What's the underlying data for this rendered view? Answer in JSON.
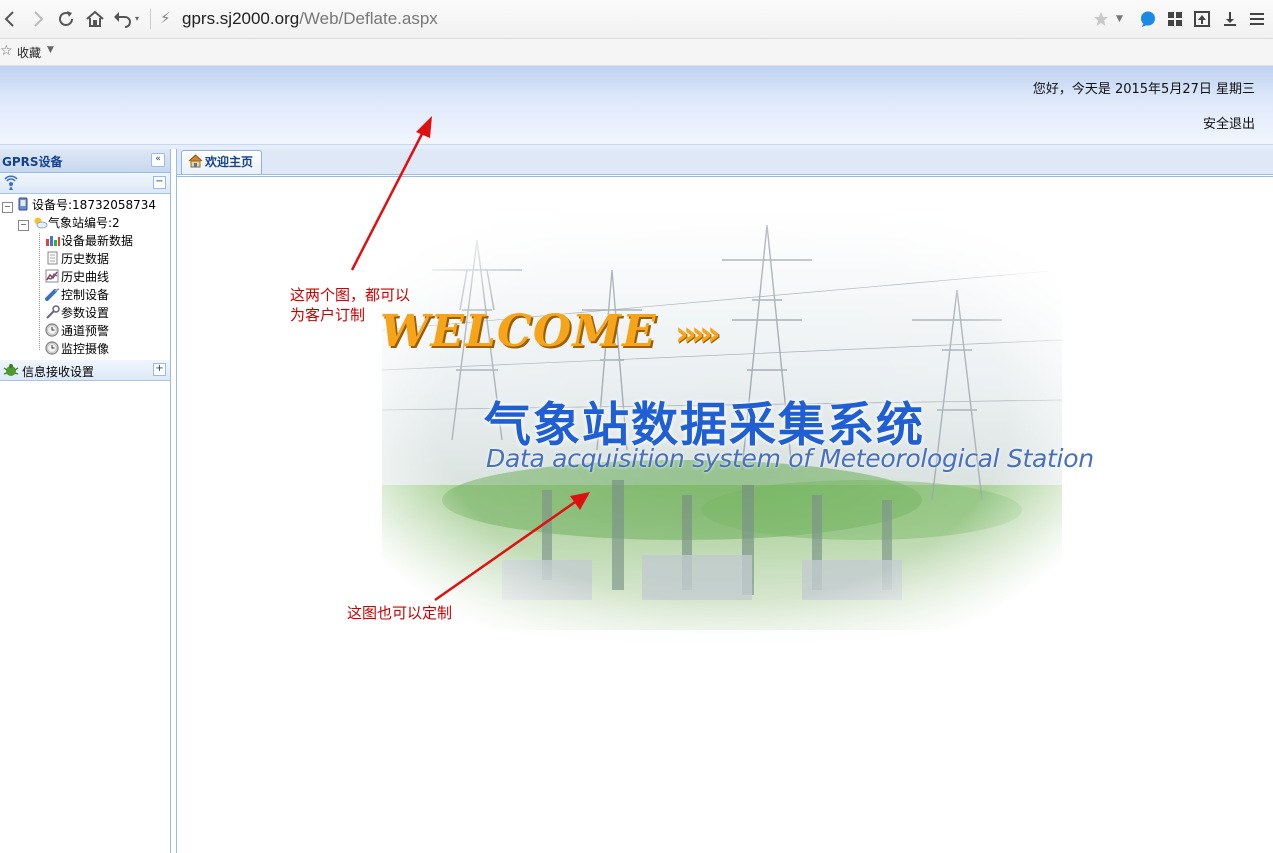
{
  "browser": {
    "address_host": "gprs.sj2000.org",
    "address_path": "/Web/Deflate.aspx",
    "bookmark_label": "收藏"
  },
  "header": {
    "greeting": "您好，今天是 2015年5月27日 星期三",
    "logout": "安全退出"
  },
  "sidebar": {
    "title": "GPRS设备",
    "device": "设备号:18732058734",
    "station": "气象站编号:2",
    "items": [
      {
        "label": "设备最新数据",
        "icon": "bar-chart-icon"
      },
      {
        "label": "历史数据",
        "icon": "document-icon"
      },
      {
        "label": "历史曲线",
        "icon": "line-chart-icon"
      },
      {
        "label": "控制设备",
        "icon": "wrench-icon"
      },
      {
        "label": "参数设置",
        "icon": "key-icon"
      },
      {
        "label": "通道预警",
        "icon": "clock-icon"
      },
      {
        "label": "监控摄像",
        "icon": "clock-icon"
      }
    ],
    "section2_label": "信息接收设置"
  },
  "tabs": {
    "home_label": "欢迎主页"
  },
  "banner": {
    "welcome": "WELCOME",
    "welcome_arrows": "›››››",
    "title_cn": "气象站数据采集系统",
    "title_en": "Data acquisition system of Meteorological Station"
  },
  "annotations": {
    "note1_line1": "这两个图，都可以",
    "note1_line2": "为客户订制",
    "note2": "这图也可以定制"
  },
  "colors": {
    "panel_border": "#99bbe8",
    "title_blue": "#1f5ed3",
    "welcome_orange": "#f6a51a",
    "annotation_red": "#cc0000"
  }
}
